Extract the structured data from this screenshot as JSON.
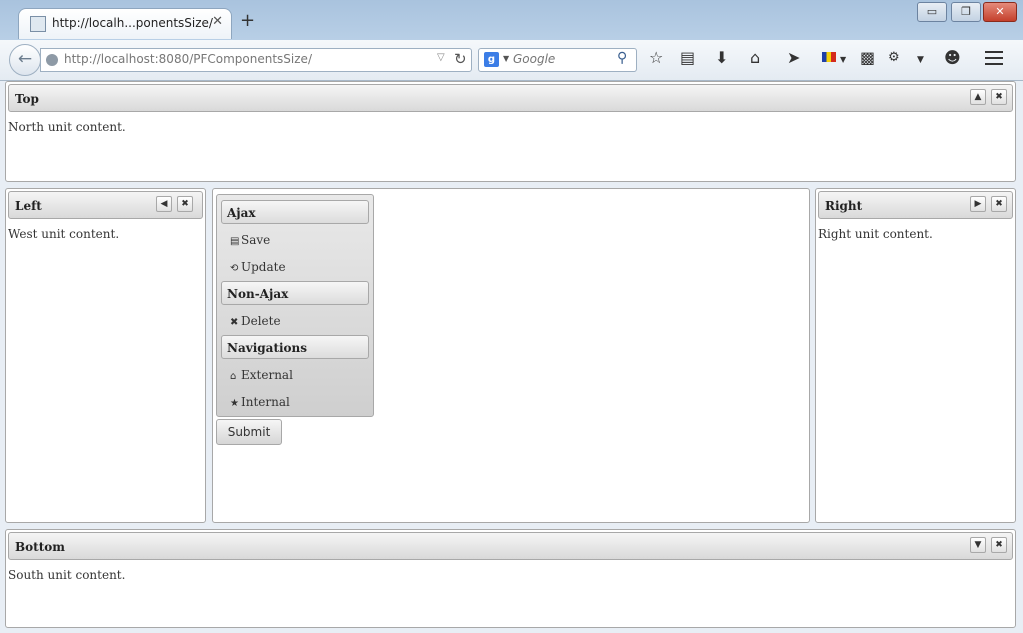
{
  "browser": {
    "tab_title": "http://localh...ponentsSize/",
    "tab_close": "✕",
    "new_tab": "+",
    "url": "http://localhost:8080/PFComponentsSize/",
    "search_placeholder": "Google",
    "window_controls": {
      "minimize": "▭",
      "maximize": "❐",
      "close": "✕"
    },
    "toolbar_icons": [
      "star-icon",
      "reading-list-icon",
      "download-icon",
      "home-icon",
      "send-icon",
      "flag-icon",
      "chat-icon",
      "addon-icon",
      "overflow-icon",
      "smiley-icon",
      "hamburger-icon"
    ]
  },
  "layout": {
    "north": {
      "title": "Top",
      "content": "North unit content.",
      "buttons": [
        "▲",
        "✖"
      ]
    },
    "west": {
      "title": "Left",
      "content": "West unit content.",
      "buttons": [
        "◀",
        "✖"
      ]
    },
    "east": {
      "title": "Right",
      "content": "Right unit content.",
      "buttons": [
        "▶",
        "✖"
      ]
    },
    "south": {
      "title": "Bottom",
      "content": "South unit content.",
      "buttons": [
        "▼",
        "✖"
      ]
    },
    "center": {
      "menu": {
        "groups": [
          {
            "heading": "Ajax",
            "items": [
              {
                "label": "Save",
                "icon": "disk-icon"
              },
              {
                "label": "Update",
                "icon": "refresh-icon"
              }
            ]
          },
          {
            "heading": "Non-Ajax",
            "items": [
              {
                "label": "Delete",
                "icon": "close-icon"
              }
            ]
          },
          {
            "heading": "Navigations",
            "items": [
              {
                "label": "External",
                "icon": "home-icon"
              },
              {
                "label": "Internal",
                "icon": "star-icon"
              }
            ]
          }
        ]
      },
      "submit_label": "Submit"
    }
  }
}
